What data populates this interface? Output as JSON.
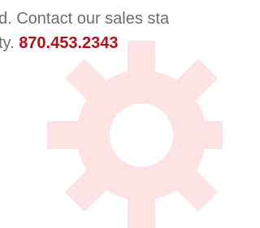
{
  "content": {
    "line1_text": "d.  Contact our sales sta",
    "line2_prefix": "ty. ",
    "phone": "870.453.2343"
  },
  "theme": {
    "gear_color": "#fde3e3",
    "text_color": "#6d6d6d",
    "phone_color": "#b0121b"
  },
  "icons": {
    "background_icon": "gear-icon"
  }
}
